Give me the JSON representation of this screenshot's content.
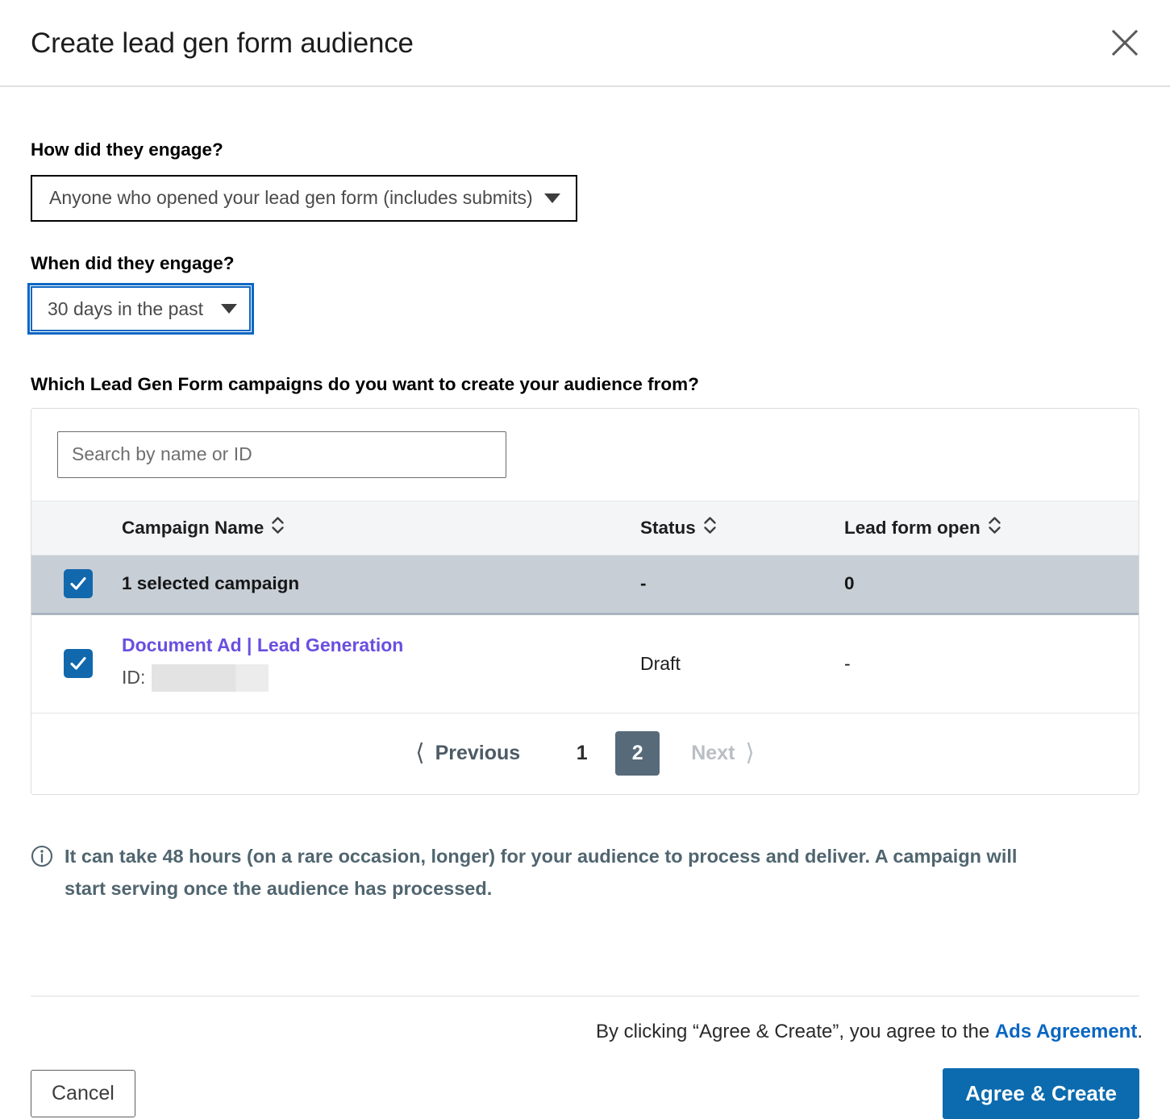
{
  "header": {
    "title": "Create lead gen form audience",
    "close_icon": "close-icon"
  },
  "engage_how": {
    "label": "How did they engage?",
    "selected": "Anyone who opened your lead gen form (includes submits)",
    "caret_icon": "chevron-down-icon"
  },
  "engage_when": {
    "label": "When did they engage?",
    "selected": "30 days in the past",
    "caret_icon": "chevron-down-icon",
    "focus_color": "#0b66c3"
  },
  "campaigns": {
    "label": "Which Lead Gen Form campaigns do you want to create your audience from?",
    "search": {
      "placeholder": "Search by name or ID",
      "value": ""
    },
    "columns": [
      {
        "label": "Campaign Name",
        "sort_icon": "sort-updown-icon"
      },
      {
        "label": "Status",
        "sort_icon": "sort-updown-icon"
      },
      {
        "label": "Lead form open",
        "sort_icon": "sort-updown-icon"
      }
    ],
    "summary_row": {
      "checked": true,
      "name": "1 selected campaign",
      "status": "-",
      "lead_form_open": "0",
      "highlight_color": "#c7ced6"
    },
    "rows": [
      {
        "checked": true,
        "name": "Document Ad | Lead Generation",
        "name_color": "#6a4fe0",
        "id_label": "ID:",
        "id_value": "",
        "id_redacted": true,
        "status": "Draft",
        "lead_form_open": "-"
      }
    ],
    "pagination": {
      "previous_label": "Previous",
      "previous_icon": "chevron-left-icon",
      "next_label": "Next",
      "next_icon": "chevron-right-icon",
      "next_disabled": true,
      "pages": [
        "1",
        "2"
      ],
      "active_page": "2",
      "active_bg": "#566a7a"
    }
  },
  "notice": {
    "icon": "info-circle-icon",
    "text": "It can take 48 hours (on a rare occasion, longer) for your audience to process and deliver. A campaign will start serving once the audience has processed.",
    "color": "#50656f"
  },
  "footer": {
    "agreement_prefix": "By clicking “Agree & Create”, you agree to the ",
    "agreement_link": "Ads Agreement",
    "agreement_suffix": ".",
    "link_color": "#0a66c2",
    "cancel_label": "Cancel",
    "primary_label": "Agree & Create",
    "primary_color": "#0b6bae"
  }
}
